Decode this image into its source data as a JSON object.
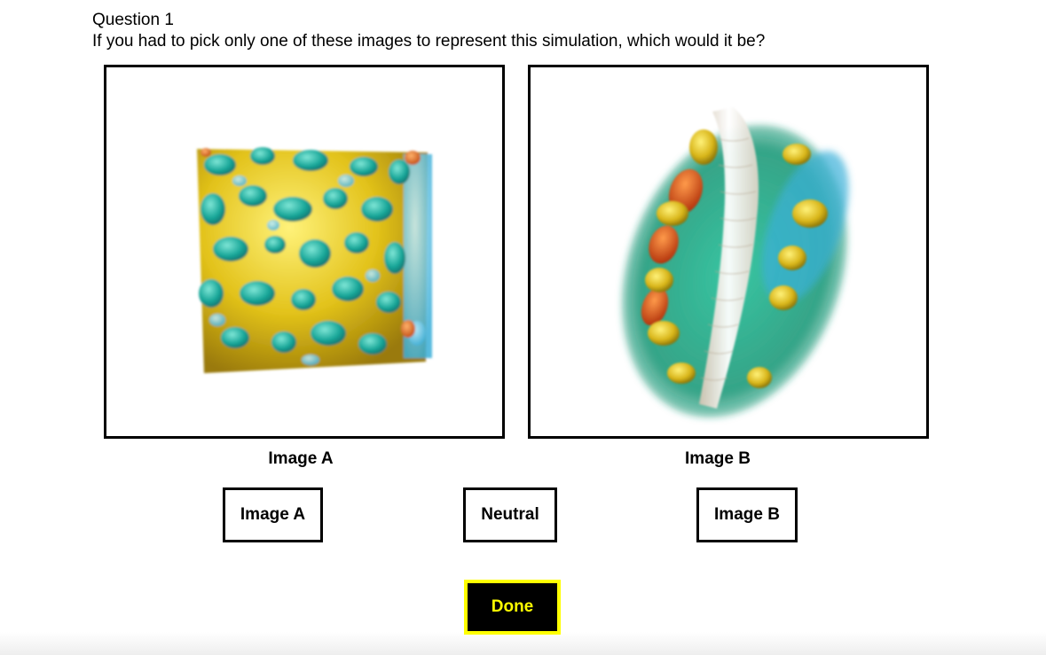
{
  "question": {
    "title": "Question 1",
    "text": "If you had to pick only one of these images to represent this simulation, which would it be?"
  },
  "images": [
    {
      "caption": "Image A"
    },
    {
      "caption": "Image B"
    }
  ],
  "choices": {
    "image_a_label": "Image A",
    "neutral_label": "Neutral",
    "image_b_label": "Image B"
  },
  "done_label": "Done",
  "colors": {
    "done_background": "#000000",
    "done_border_and_text": "#ffff00",
    "frame_border": "#000000"
  }
}
